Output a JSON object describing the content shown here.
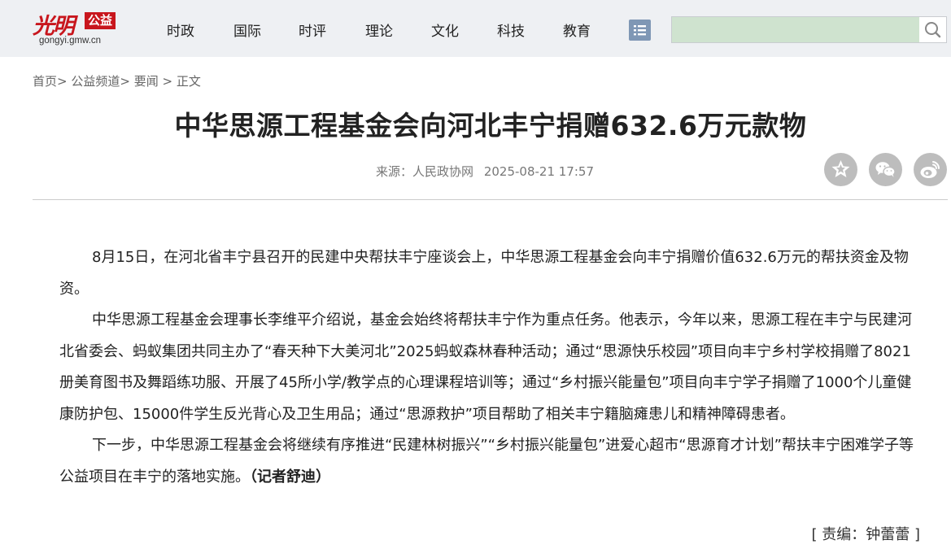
{
  "header": {
    "logo_script": "光明",
    "logo_badge": "公益",
    "logo_domain": "gongyi.gmw.cn",
    "nav": [
      "时政",
      "国际",
      "时评",
      "理论",
      "文化",
      "科技",
      "教育"
    ],
    "search_placeholder": ""
  },
  "breadcrumb": {
    "home": "首页",
    "channel": "公益频道",
    "section": "要闻",
    "current": "正文",
    "separator": ">"
  },
  "article": {
    "title": "中华思源工程基金会向河北丰宁捐赠632.6万元款物",
    "source": "来源：人民政协网",
    "datetime": "2025-08-21 17:57",
    "paragraphs": [
      "8月15日，在河北省丰宁县召开的民建中央帮扶丰宁座谈会上，中华思源工程基金会向丰宁捐赠价值632.6万元的帮扶资金及物资。",
      "中华思源工程基金会理事长李维平介绍说，基金会始终将帮扶丰宁作为重点任务。他表示，今年以来，思源工程在丰宁与民建河北省委会、蚂蚁集团共同主办了“春天种下大美河北”2025蚂蚁森林春种活动；通过“思源快乐校园”项目向丰宁乡村学校捐赠了8021册美育图书及舞蹈练功服、开展了45所小学/教学点的心理课程培训等；通过“乡村振兴能量包”项目向丰宁学子捐赠了1000个儿童健康防护包、15000件学生反光背心及卫生用品；通过“思源救护”项目帮助了相关丰宁籍脑瘫患儿和精神障碍患者。",
      "下一步，中华思源工程基金会将继续有序推进“民建林树振兴”“乡村振兴能量包”进爱心超市“思源育才计划”帮扶丰宁困难学子等公益项目在丰宁的落地实施。"
    ],
    "reporter": "（记者舒迪）",
    "editor": "[ 责编：钟蕾蕾 ]"
  },
  "icons": {
    "menu": "list-menu-icon",
    "search": "search-icon",
    "favorite": "star-icon",
    "wechat": "wechat-icon",
    "weibo": "weibo-icon"
  },
  "colors": {
    "brand_red": "#c8161d",
    "header_bg": "#eef0f3",
    "search_bg": "#cfe3cf",
    "menu_button": "#7f97b5",
    "share_gray": "#bdbdbd"
  }
}
